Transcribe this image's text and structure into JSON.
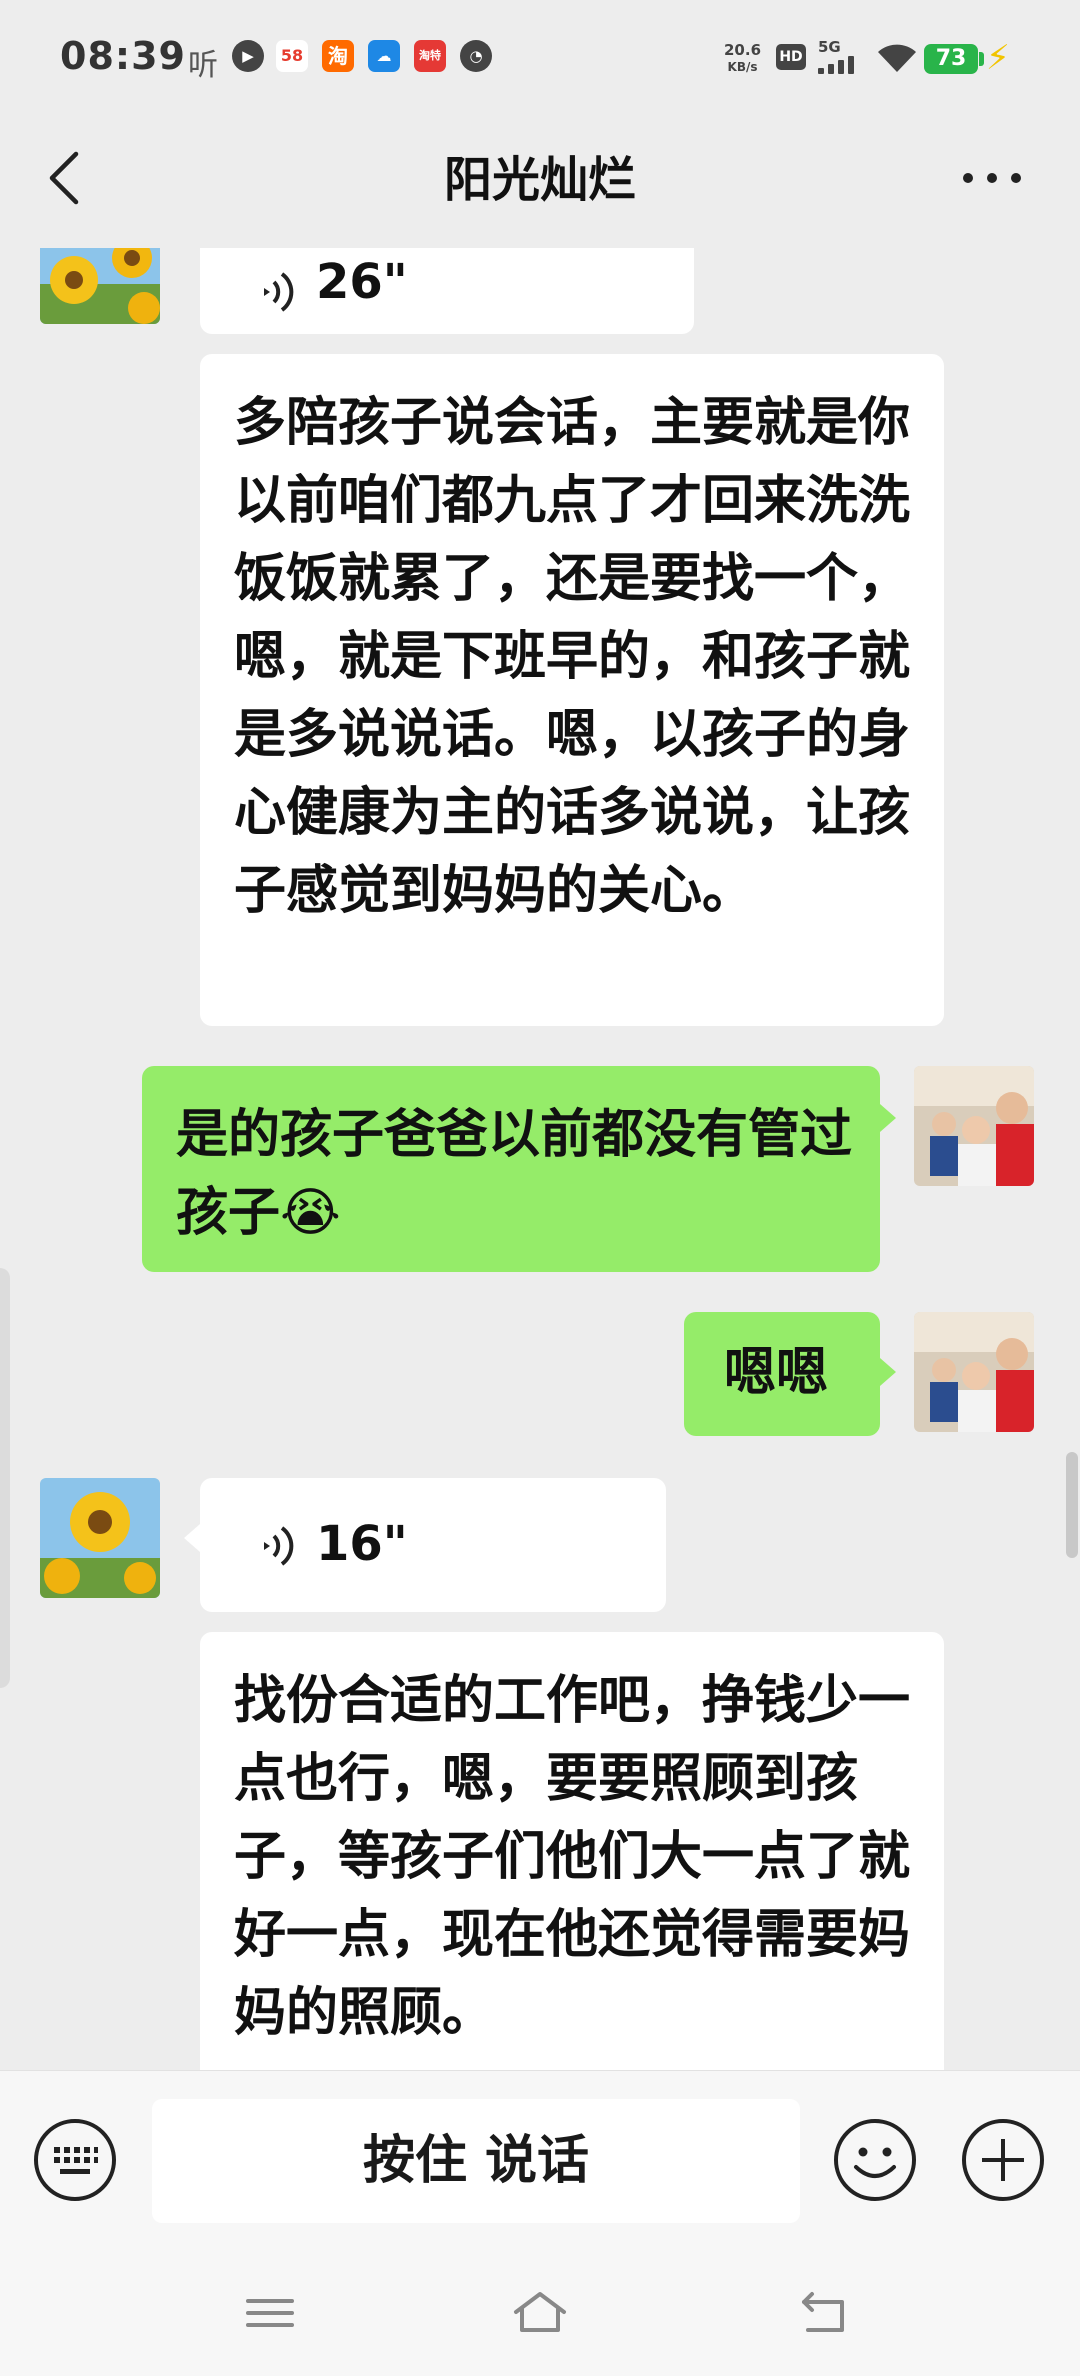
{
  "status_bar": {
    "time": "08:39",
    "app_ting": "听",
    "app_58": "58",
    "app_taobao": "淘",
    "app_lovefree": "淘特",
    "net_speed_value": "20.6",
    "net_speed_unit": "KB/s",
    "hd": "HD",
    "network": "5G",
    "battery": "73"
  },
  "header": {
    "title": "阳光灿烂"
  },
  "messages": {
    "voice1": {
      "duration": "26\""
    },
    "text1": "多陪孩子说会话，主要就是你以前咱们都九点了才回来洗洗饭饭就累了，还是要找一个，嗯，就是下班早的，和孩子就是多说说话。嗯，以孩子的身心健康为主的话多说说，让孩子感觉到妈妈的关心。",
    "sent1": "是的孩子爸爸以前都没有管过孩子",
    "sent1_emoji": "😭",
    "sent2": "嗯嗯",
    "voice2": {
      "duration": "16\""
    },
    "text2": "找份合适的工作吧，挣钱少一点也行，嗯，要要照顾到孩子，等孩子们他们大一点了就好一点，现在他还觉得需要妈妈的照顾。"
  },
  "input_bar": {
    "hold_to_talk": "按住 说话"
  },
  "colors": {
    "background": "#ededed",
    "sent_bubble": "#95ec69",
    "received_bubble": "#ffffff"
  },
  "icons": [
    "back-arrow-icon",
    "more-icon",
    "voice-wave-icon",
    "keyboard-icon",
    "emoji-icon",
    "plus-icon",
    "menu-icon",
    "home-icon",
    "return-icon"
  ]
}
